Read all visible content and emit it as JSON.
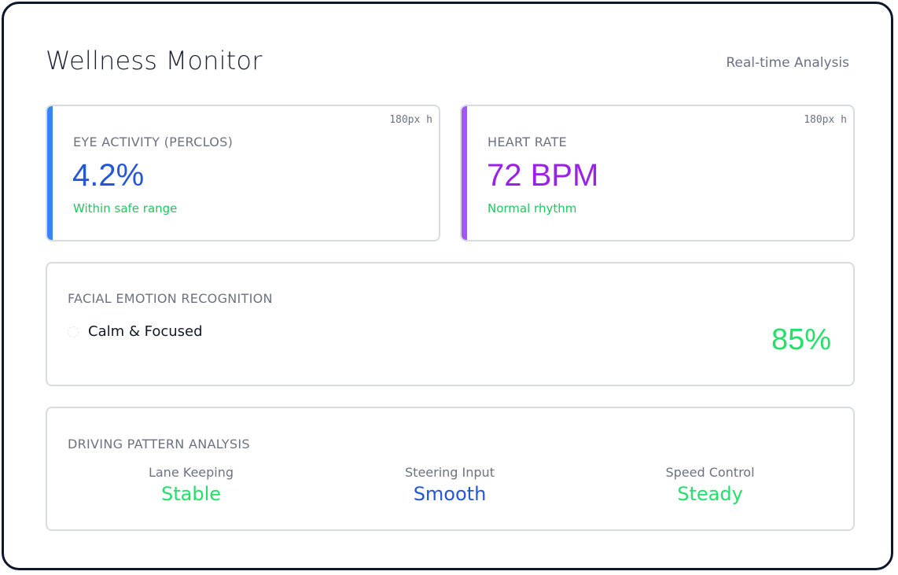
{
  "header": {
    "title": "Wellness Monitor",
    "subtitle": "Real-time Analysis"
  },
  "eye_activity": {
    "label": "EYE ACTIVITY (PERCLOS)",
    "note": "180px h",
    "value": "4.2%",
    "status": "Within safe range",
    "accent_color": "#3b82f6",
    "value_color": "#2456d6",
    "status_color": "#22c55e"
  },
  "heart_rate": {
    "label": "HEART RATE",
    "note": "180px h",
    "value": "72 BPM",
    "status": "Normal rhythm",
    "accent_color": "#a855f7",
    "value_color": "#9b21e8",
    "status_color": "#22c55e"
  },
  "emotion": {
    "label": "FACIAL EMOTION RECOGNITION",
    "icon": "emotion-face-icon",
    "state": "Calm & Focused",
    "confidence": "85%",
    "confidence_color": "#22e06a"
  },
  "driving": {
    "label": "DRIVING PATTERN ANALYSIS",
    "metrics": [
      {
        "label": "Lane Keeping",
        "value": "Stable",
        "color": "#22e06a"
      },
      {
        "label": "Steering Input",
        "value": "Smooth",
        "color": "#2456d6"
      },
      {
        "label": "Speed Control",
        "value": "Steady",
        "color": "#22e06a"
      }
    ]
  }
}
